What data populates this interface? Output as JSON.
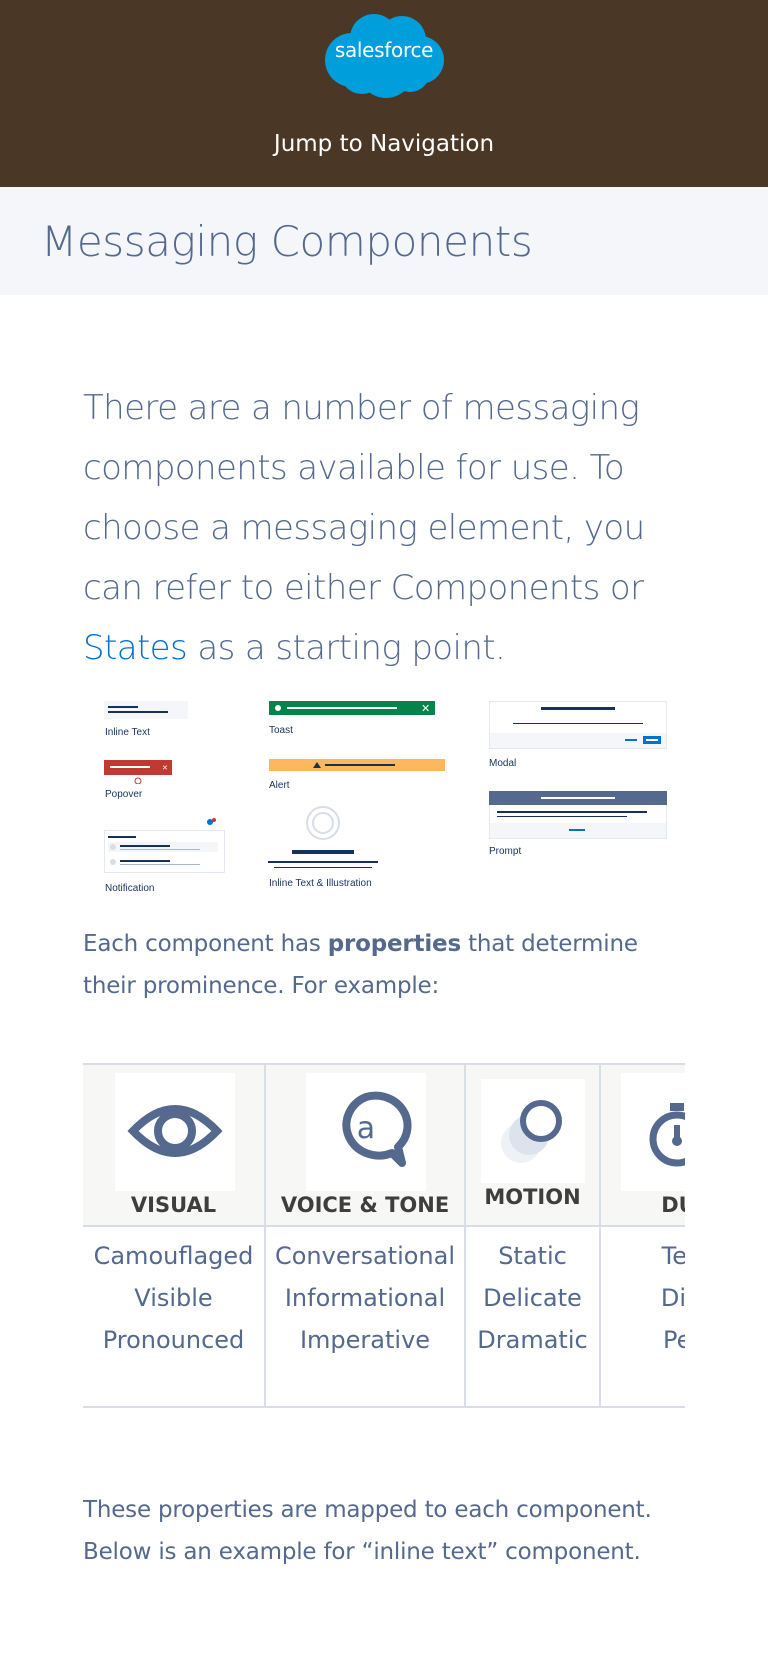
{
  "header": {
    "logo_text": "salesforce",
    "jump_link": "Jump to Navigation",
    "brand_color": "#4a3725",
    "logo_color": "#009edb"
  },
  "page": {
    "title": "Messaging Components"
  },
  "intro": {
    "text_before": "There are a number of messaging components available for use. To choose a messaging element, you can refer to either Components or ",
    "link": "States",
    "text_after": " as a starting point."
  },
  "thumbnails": [
    {
      "label": "Inline Text"
    },
    {
      "label": "Toast"
    },
    {
      "label": "Modal"
    },
    {
      "label": "Popover"
    },
    {
      "label": "Alert"
    },
    {
      "label": "Prompt"
    },
    {
      "label": "Notification"
    },
    {
      "label": "Inline Text & Illustration"
    }
  ],
  "properties_intro": {
    "before": "Each component has ",
    "bold": "properties",
    "after": " that determine their prominence. For example:"
  },
  "property_table": {
    "columns": [
      {
        "title": "VISUAL",
        "icon": "eye-icon",
        "values": [
          "Camouflaged",
          "Visible",
          "Pronounced"
        ]
      },
      {
        "title": "VOICE & TONE",
        "icon": "speech-bubble-icon",
        "values": [
          "Conversational",
          "Informational",
          "Imperative"
        ]
      },
      {
        "title": "MOTION",
        "icon": "motion-circles-icon",
        "values": [
          "Static",
          "Delicate",
          "Dramatic"
        ]
      },
      {
        "title": "DURAT",
        "icon": "stopwatch-icon",
        "values": [
          "Tempo",
          "Dismis",
          "Perma"
        ]
      }
    ]
  },
  "mapped": {
    "text": "These properties are mapped to each component. Below is an example for “inline text” component."
  }
}
